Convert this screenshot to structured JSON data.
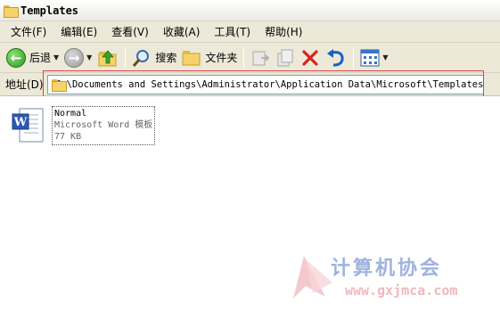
{
  "window": {
    "title": "Templates"
  },
  "menu": [
    "文件(F)",
    "编辑(E)",
    "查看(V)",
    "收藏(A)",
    "工具(T)",
    "帮助(H)"
  ],
  "toolbar": {
    "back_label": "后退",
    "search_label": "搜索",
    "folders_label": "文件夹"
  },
  "address": {
    "label": "地址(D)",
    "path": "C:\\Documents and Settings\\Administrator\\Application Data\\Microsoft\\Templates"
  },
  "files": [
    {
      "name": "Normal",
      "type": "Microsoft Word 模板",
      "size": "77 KB",
      "icon": "word-document-icon"
    }
  ],
  "watermark": {
    "text": "计算机协会",
    "url": "www.gxjmca.com"
  },
  "colors": {
    "highlight": "#d64545",
    "chrome": "#ece9d8"
  }
}
